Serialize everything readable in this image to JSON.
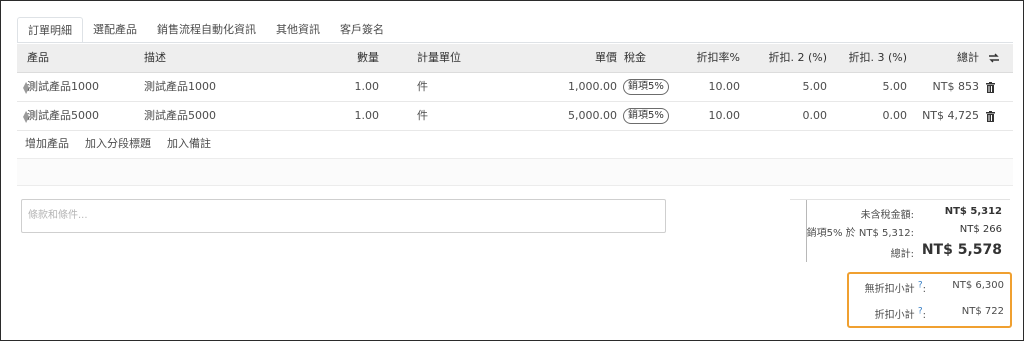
{
  "tabs": [
    "訂單明細",
    "選配產品",
    "銷售流程自動化資訊",
    "其他資訊",
    "客戶簽名"
  ],
  "table": {
    "headers": {
      "product": "產品",
      "description": "描述",
      "quantity": "數量",
      "uom": "計量單位",
      "price": "單價",
      "tax": "稅金",
      "discount": "折扣率%",
      "discount2": "折扣. 2 (%)",
      "discount3": "折扣. 3 (%)",
      "total": "總計"
    },
    "rows": [
      {
        "product": "測試產品1000",
        "description": "測試產品1000",
        "quantity": "1.00",
        "uom": "件",
        "price": "1,000.00",
        "tax": "銷項5%",
        "discount": "10.00",
        "discount2": "5.00",
        "discount3": "5.00",
        "total": "NT$ 853"
      },
      {
        "product": "測試產品5000",
        "description": "測試產品5000",
        "quantity": "1.00",
        "uom": "件",
        "price": "5,000.00",
        "tax": "銷項5%",
        "discount": "10.00",
        "discount2": "0.00",
        "discount3": "0.00",
        "total": "NT$ 4,725"
      }
    ],
    "icons": {
      "sort": "sort-arrows-icon",
      "delete": "trash-icon",
      "drag": "drag-handle-icon"
    }
  },
  "actions": {
    "add_product": "增加產品",
    "add_section": "加入分段標題",
    "add_note": "加入備註"
  },
  "notes": {
    "placeholder": "條款和條件..."
  },
  "totals": {
    "untaxed_label": "未含稅金額:",
    "untaxed_value": "NT$ 5,312",
    "tax_label": "銷項5% 於 NT$ 5,312:",
    "tax_value": "NT$ 266",
    "total_label": "總計:",
    "total_value": "NT$ 5,578"
  },
  "subtotals": {
    "no_discount_label": "無折扣小計",
    "no_discount_value": "NT$ 6,300",
    "discount_label": "折扣小計",
    "discount_value": "NT$ 722",
    "help_mark": "?"
  },
  "colors": {
    "highlight": "#f0a030",
    "header_bg": "#eeeeee",
    "help_mark": "#3a80c5"
  }
}
